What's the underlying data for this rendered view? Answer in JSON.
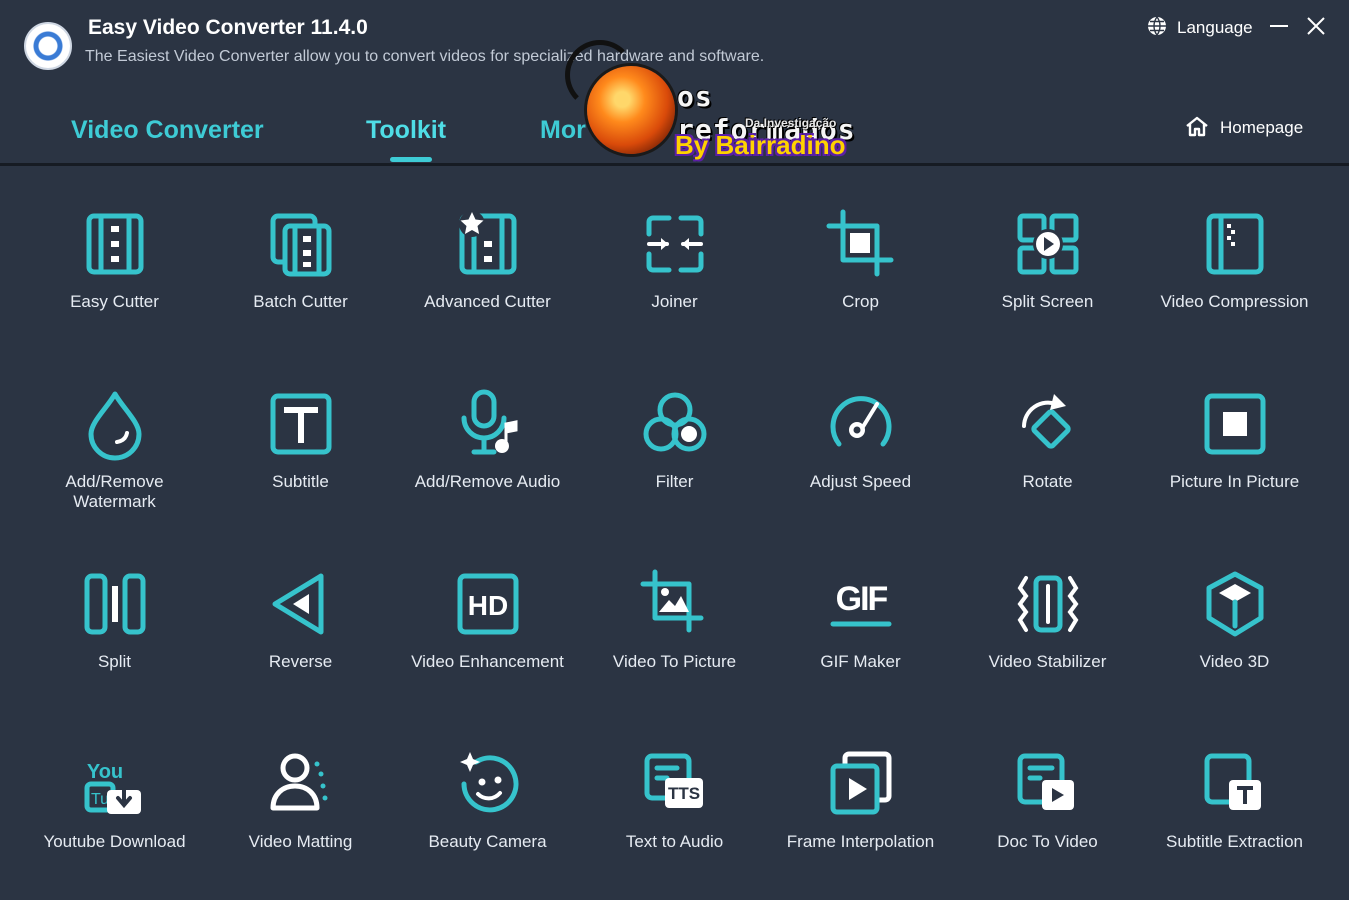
{
  "app": {
    "title": "Easy Video Converter 11.4.0",
    "subtitle": "The Easiest Video Converter allow you to convert videos for specialized hardware and software."
  },
  "window_controls": {
    "language_label": "Language"
  },
  "tabs": [
    {
      "label": "Video Converter"
    },
    {
      "label": "Toolkit"
    },
    {
      "label": "Mor"
    }
  ],
  "homepage_label": "Homepage",
  "watermark": {
    "line1": "os reformados",
    "line2": "Da Investigação",
    "line3": "By Bairradino"
  },
  "tools": [
    {
      "label": "Easy Cutter",
      "icon": "film-icon"
    },
    {
      "label": "Batch Cutter",
      "icon": "stacked-film-icon"
    },
    {
      "label": "Advanced Cutter",
      "icon": "film-star-icon"
    },
    {
      "label": "Joiner",
      "icon": "join-icon"
    },
    {
      "label": "Crop",
      "icon": "crop-icon"
    },
    {
      "label": "Split Screen",
      "icon": "split-screen-icon"
    },
    {
      "label": "Video Compression",
      "icon": "compress-film-icon"
    },
    {
      "label": "Add/Remove Watermark",
      "icon": "drop-icon"
    },
    {
      "label": "Subtitle",
      "icon": "text-t-icon"
    },
    {
      "label": "Add/Remove Audio",
      "icon": "microphone-note-icon"
    },
    {
      "label": "Filter",
      "icon": "filter-circles-icon"
    },
    {
      "label": "Adjust Speed",
      "icon": "speedometer-icon"
    },
    {
      "label": "Rotate",
      "icon": "rotate-icon"
    },
    {
      "label": "Picture In Picture",
      "icon": "picture-in-picture-icon"
    },
    {
      "label": "Split",
      "icon": "split-bars-icon"
    },
    {
      "label": "Reverse",
      "icon": "reverse-triangle-icon"
    },
    {
      "label": "Video Enhancement",
      "icon": "hd-icon"
    },
    {
      "label": "Video To Picture",
      "icon": "image-crop-icon"
    },
    {
      "label": "GIF Maker",
      "icon": "gif-icon"
    },
    {
      "label": "Video Stabilizer",
      "icon": "stabilizer-icon"
    },
    {
      "label": "Video 3D",
      "icon": "cube-icon"
    },
    {
      "label": "Youtube Download",
      "icon": "youtube-download-icon"
    },
    {
      "label": "Video Matting",
      "icon": "person-matting-icon"
    },
    {
      "label": "Beauty Camera",
      "icon": "face-sparkle-icon"
    },
    {
      "label": "Text to Audio",
      "icon": "tts-icon"
    },
    {
      "label": "Frame Interpolation",
      "icon": "frame-play-icon"
    },
    {
      "label": "Doc To Video",
      "icon": "doc-play-icon"
    },
    {
      "label": "Subtitle Extraction",
      "icon": "subtitle-extract-icon"
    }
  ],
  "colors": {
    "background": "#2b3443",
    "accent": "#36c3cc",
    "text": "#e6ebf2"
  }
}
